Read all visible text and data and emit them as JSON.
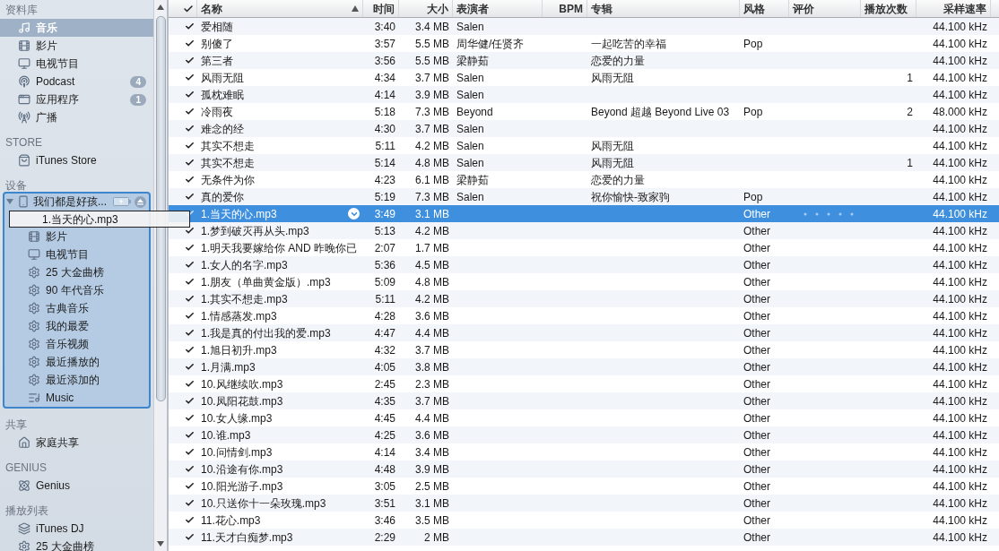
{
  "sidebar": {
    "sections": [
      {
        "heading": "资料库",
        "items": [
          {
            "kind": "music",
            "label": "音乐",
            "selected": true
          },
          {
            "kind": "movies",
            "label": "影片",
            "selected": false
          },
          {
            "kind": "tv",
            "label": "电视节目",
            "selected": false
          },
          {
            "kind": "podcast",
            "label": "Podcast",
            "badge": "4",
            "selected": false
          },
          {
            "kind": "apps",
            "label": "应用程序",
            "badge": "1",
            "selected": false
          },
          {
            "kind": "radio",
            "label": "广播",
            "selected": false
          }
        ]
      },
      {
        "heading": "STORE",
        "items": [
          {
            "kind": "store",
            "label": "iTunes Store",
            "selected": false
          }
        ]
      },
      {
        "heading": "设备",
        "device": {
          "label": "我们都是好孩...",
          "expanded": true,
          "children": [
            {
              "kind": "hidden"
            },
            {
              "kind": "movies",
              "label": "影片"
            },
            {
              "kind": "tv",
              "label": "电视节目"
            },
            {
              "kind": "smart-playlist",
              "label": "25 大金曲榜"
            },
            {
              "kind": "smart-playlist",
              "label": "90 年代音乐"
            },
            {
              "kind": "smart-playlist",
              "label": "古典音乐"
            },
            {
              "kind": "smart-playlist",
              "label": "我的最爱"
            },
            {
              "kind": "smart-playlist",
              "label": "音乐视频"
            },
            {
              "kind": "smart-playlist",
              "label": "最近播放的"
            },
            {
              "kind": "smart-playlist",
              "label": "最近添加的"
            },
            {
              "kind": "playlist",
              "label": "Music"
            }
          ]
        }
      },
      {
        "heading": "共享",
        "items": [
          {
            "kind": "home",
            "label": "家庭共享",
            "selected": false
          }
        ]
      },
      {
        "heading": "GENIUS",
        "items": [
          {
            "kind": "genius",
            "label": "Genius",
            "selected": false
          }
        ]
      },
      {
        "heading": "播放列表",
        "items": [
          {
            "kind": "dj",
            "label": "iTunes DJ",
            "selected": false
          },
          {
            "kind": "smart-playlist",
            "label": "25 大金曲榜",
            "selected": false
          }
        ]
      }
    ]
  },
  "drag_ghost": {
    "label": "1.当天的心.mp3"
  },
  "table": {
    "columns": [
      "名称",
      "时间",
      "大小",
      "表演者",
      "BPM",
      "专辑",
      "风格",
      "评价",
      "播放次数",
      "采样速率"
    ],
    "rows": [
      {
        "checked": true,
        "selected": false,
        "name": "爱相随",
        "time": "3:40",
        "size": "3.4 MB",
        "artist": "Salen",
        "album": "",
        "genre": "",
        "plays": "",
        "rate": "44.100 kHz"
      },
      {
        "checked": true,
        "selected": false,
        "name": "别傻了",
        "time": "3:57",
        "size": "5.5 MB",
        "artist": "周华健/任贤齐",
        "album": "一起吃苦的幸福",
        "genre": "Pop",
        "plays": "",
        "rate": "44.100 kHz"
      },
      {
        "checked": true,
        "selected": false,
        "name": "第三者",
        "time": "3:56",
        "size": "5.5 MB",
        "artist": "梁静茹",
        "album": "恋爱的力量",
        "genre": "",
        "plays": "",
        "rate": "44.100 kHz"
      },
      {
        "checked": true,
        "selected": false,
        "name": "风雨无阻",
        "time": "4:34",
        "size": "3.7 MB",
        "artist": "Salen",
        "album": "风雨无阻",
        "genre": "",
        "plays": "1",
        "rate": "44.100 kHz"
      },
      {
        "checked": true,
        "selected": false,
        "name": "孤枕难眠",
        "time": "4:14",
        "size": "3.9 MB",
        "artist": "Salen",
        "album": "",
        "genre": "",
        "plays": "",
        "rate": "44.100 kHz"
      },
      {
        "checked": true,
        "selected": false,
        "name": "冷雨夜",
        "time": "5:18",
        "size": "7.3 MB",
        "artist": "Beyond",
        "album": "Beyond 超越 Beyond Live 03",
        "genre": "Pop",
        "plays": "2",
        "rate": "48.000 kHz"
      },
      {
        "checked": true,
        "selected": false,
        "name": "难念的经",
        "time": "4:30",
        "size": "3.7 MB",
        "artist": "Salen",
        "album": "",
        "genre": "",
        "plays": "",
        "rate": "44.100 kHz"
      },
      {
        "checked": true,
        "selected": false,
        "name": "其实不想走",
        "time": "5:11",
        "size": "4.2 MB",
        "artist": "Salen",
        "album": "风雨无阻",
        "genre": "",
        "plays": "",
        "rate": "44.100 kHz"
      },
      {
        "checked": true,
        "selected": false,
        "name": "其实不想走",
        "time": "5:14",
        "size": "4.8 MB",
        "artist": "Salen",
        "album": "风雨无阻",
        "genre": "",
        "plays": "1",
        "rate": "44.100 kHz"
      },
      {
        "checked": true,
        "selected": false,
        "name": "无条件为你",
        "time": "4:23",
        "size": "6.1 MB",
        "artist": "梁静茹",
        "album": "恋爱的力量",
        "genre": "",
        "plays": "",
        "rate": "44.100 kHz"
      },
      {
        "checked": true,
        "selected": false,
        "name": "真的爱你",
        "time": "5:19",
        "size": "7.3 MB",
        "artist": "Salen",
        "album": "祝你愉快-致家驹",
        "genre": "Pop",
        "plays": "",
        "rate": "44.100 kHz"
      },
      {
        "checked": true,
        "selected": true,
        "name": "1.当天的心.mp3",
        "time": "3:49",
        "size": "3.1 MB",
        "artist": "",
        "album": "",
        "genre": "Other",
        "plays": "",
        "rate": "44.100 kHz"
      },
      {
        "checked": true,
        "selected": false,
        "name": "1.梦到破灭再从头.mp3",
        "time": "5:13",
        "size": "4.2 MB",
        "artist": "",
        "album": "",
        "genre": "Other",
        "plays": "",
        "rate": "44.100 kHz"
      },
      {
        "checked": true,
        "selected": false,
        "name": "1.明天我要嫁给你 AND 昨晚你已",
        "time": "2:07",
        "size": "1.7 MB",
        "artist": "",
        "album": "",
        "genre": "Other",
        "plays": "",
        "rate": "44.100 kHz"
      },
      {
        "checked": true,
        "selected": false,
        "name": "1.女人的名字.mp3",
        "time": "5:36",
        "size": "4.5 MB",
        "artist": "",
        "album": "",
        "genre": "Other",
        "plays": "",
        "rate": "44.100 kHz"
      },
      {
        "checked": true,
        "selected": false,
        "name": "1.朋友（单曲黄金版）.mp3",
        "time": "5:09",
        "size": "4.8 MB",
        "artist": "",
        "album": "",
        "genre": "Other",
        "plays": "",
        "rate": "44.100 kHz"
      },
      {
        "checked": true,
        "selected": false,
        "name": "1.其实不想走.mp3",
        "time": "5:11",
        "size": "4.2 MB",
        "artist": "",
        "album": "",
        "genre": "Other",
        "plays": "",
        "rate": "44.100 kHz"
      },
      {
        "checked": true,
        "selected": false,
        "name": "1.情感蒸发.mp3",
        "time": "4:28",
        "size": "3.6 MB",
        "artist": "",
        "album": "",
        "genre": "Other",
        "plays": "",
        "rate": "44.100 kHz"
      },
      {
        "checked": true,
        "selected": false,
        "name": "1.我是真的付出我的爱.mp3",
        "time": "4:47",
        "size": "4.4 MB",
        "artist": "",
        "album": "",
        "genre": "Other",
        "plays": "",
        "rate": "44.100 kHz"
      },
      {
        "checked": true,
        "selected": false,
        "name": "1.旭日初升.mp3",
        "time": "4:32",
        "size": "3.7 MB",
        "artist": "",
        "album": "",
        "genre": "Other",
        "plays": "",
        "rate": "44.100 kHz"
      },
      {
        "checked": true,
        "selected": false,
        "name": "1.月满.mp3",
        "time": "4:05",
        "size": "3.8 MB",
        "artist": "",
        "album": "",
        "genre": "Other",
        "plays": "",
        "rate": "44.100 kHz"
      },
      {
        "checked": true,
        "selected": false,
        "name": "10.风继续吹.mp3",
        "time": "2:45",
        "size": "2.3 MB",
        "artist": "",
        "album": "",
        "genre": "Other",
        "plays": "",
        "rate": "44.100 kHz"
      },
      {
        "checked": true,
        "selected": false,
        "name": "10.凤阳花鼓.mp3",
        "time": "4:35",
        "size": "3.7 MB",
        "artist": "",
        "album": "",
        "genre": "Other",
        "plays": "",
        "rate": "44.100 kHz"
      },
      {
        "checked": true,
        "selected": false,
        "name": "10.女人缘.mp3",
        "time": "4:45",
        "size": "4.4 MB",
        "artist": "",
        "album": "",
        "genre": "Other",
        "plays": "",
        "rate": "44.100 kHz"
      },
      {
        "checked": true,
        "selected": false,
        "name": "10.谁.mp3",
        "time": "4:25",
        "size": "3.6 MB",
        "artist": "",
        "album": "",
        "genre": "Other",
        "plays": "",
        "rate": "44.100 kHz"
      },
      {
        "checked": true,
        "selected": false,
        "name": "10.问情剑.mp3",
        "time": "4:14",
        "size": "3.4 MB",
        "artist": "",
        "album": "",
        "genre": "Other",
        "plays": "",
        "rate": "44.100 kHz"
      },
      {
        "checked": true,
        "selected": false,
        "name": "10.沿途有你.mp3",
        "time": "4:48",
        "size": "3.9 MB",
        "artist": "",
        "album": "",
        "genre": "Other",
        "plays": "",
        "rate": "44.100 kHz"
      },
      {
        "checked": true,
        "selected": false,
        "name": "10.阳光游子.mp3",
        "time": "3:05",
        "size": "2.5 MB",
        "artist": "",
        "album": "",
        "genre": "Other",
        "plays": "",
        "rate": "44.100 kHz"
      },
      {
        "checked": true,
        "selected": false,
        "name": "10.只送你十一朵玫瑰.mp3",
        "time": "3:51",
        "size": "3.1 MB",
        "artist": "",
        "album": "",
        "genre": "Other",
        "plays": "",
        "rate": "44.100 kHz"
      },
      {
        "checked": true,
        "selected": false,
        "name": "11.花心.mp3",
        "time": "3:46",
        "size": "3.5 MB",
        "artist": "",
        "album": "",
        "genre": "Other",
        "plays": "",
        "rate": "44.100 kHz"
      },
      {
        "checked": true,
        "selected": false,
        "name": "11.天才白痴梦.mp3",
        "time": "2:29",
        "size": "2 MB",
        "artist": "",
        "album": "",
        "genre": "Other",
        "plays": "",
        "rate": "44.100 kHz"
      }
    ]
  }
}
